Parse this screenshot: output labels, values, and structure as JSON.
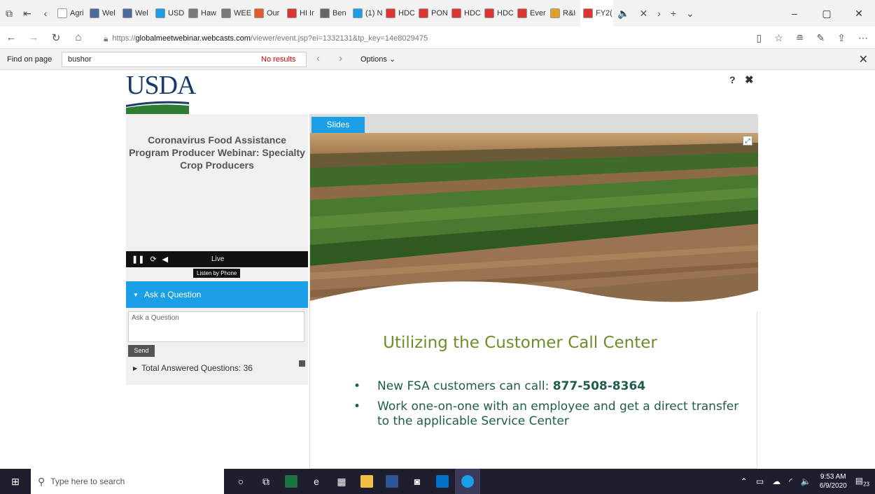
{
  "browser": {
    "tabs": [
      {
        "label": "Agri",
        "color": "#ffffff"
      },
      {
        "label": "Wel",
        "color": "#4a6b9b"
      },
      {
        "label": "Wel",
        "color": "#4a6b9b"
      },
      {
        "label": "USD",
        "color": "#1a9ee6"
      },
      {
        "label": "Haw",
        "color": "#7a7a7a"
      },
      {
        "label": "WEE",
        "color": "#7a7a7a"
      },
      {
        "label": "Our",
        "color": "#e05a2a"
      },
      {
        "label": "HI Ir",
        "color": "#d33"
      },
      {
        "label": "Ben",
        "color": "#666"
      },
      {
        "label": "(1) N",
        "color": "#1a9ee6"
      },
      {
        "label": "HDC",
        "color": "#d33"
      },
      {
        "label": "PON",
        "color": "#d33"
      },
      {
        "label": "HDC",
        "color": "#d33"
      },
      {
        "label": "HDC",
        "color": "#d33"
      },
      {
        "label": "Ever",
        "color": "#d33"
      },
      {
        "label": "R&I",
        "color": "#e0a020"
      },
      {
        "label": "FY2(",
        "color": "#d33"
      }
    ],
    "url_prefix": "https://",
    "url_host": "globalmeetwebinar.webcasts.com",
    "url_path": "/viewer/event.jsp?ei=1332131&tp_key=14e8029475"
  },
  "findbar": {
    "label": "Find on page",
    "query": "bushor",
    "results": "No results",
    "options": "Options"
  },
  "page": {
    "logo": "USDA",
    "help": "?",
    "close": "✖",
    "event_title": "Coronavirus Food Assistance Program Producer Webinar: Specialty Crop Producers",
    "live": "Live",
    "listen_by_phone": "Listen by Phone",
    "ask_header": "Ask a Question",
    "ask_placeholder": "Ask a Question",
    "send": "Send",
    "answered": "Total Answered Questions: 36",
    "slides_tab": "Slides",
    "slide_title": "Utilizing the Customer Call Center",
    "bullet1_prefix": "New FSA customers can call: ",
    "bullet1_phone": "877-508-8364",
    "bullet2": "Work one-on-one with an employee and get a direct transfer to the applicable Service Center"
  },
  "taskbar": {
    "search_placeholder": "Type here to search",
    "time": "9:53 AM",
    "date": "6/9/2020",
    "notifications": "23"
  },
  "colors": {
    "accent": "#1a9ee6",
    "slide_title": "#6b8e2a",
    "bullet_text": "#1f5c4e"
  }
}
